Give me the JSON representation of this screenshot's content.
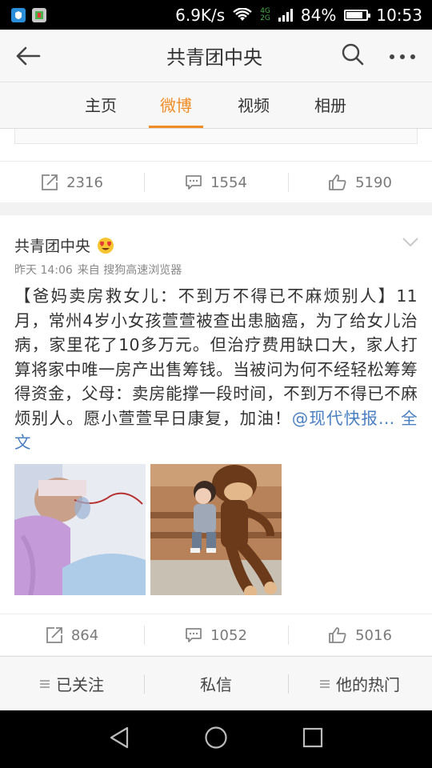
{
  "status_bar": {
    "net_speed": "6.9K/s",
    "net_4g": "4G",
    "net_2g": "2G",
    "battery": "84%",
    "battery_level": 0.84,
    "time": "10:53"
  },
  "header": {
    "title": "共青团中央"
  },
  "tabs": [
    {
      "label": "主页"
    },
    {
      "label": "微博",
      "active": true
    },
    {
      "label": "视频"
    },
    {
      "label": "相册"
    }
  ],
  "prev_post": {
    "reposts": "2316",
    "comments": "1554",
    "likes": "5190"
  },
  "post": {
    "author": "共青团中央",
    "time": "昨天 14:06",
    "source": "来自 搜狗高速浏览器",
    "text": "【爸妈卖房救女儿：不到万不得已不麻烦别人】11月，常州4岁小女孩萱萱被查出患脑癌，为了给女儿治病，家里花了10多万元。但治疗费用缺口大，家人打算将家中唯一房产出售筹钱。当被问为何不经轻松筹筹得资金，父母：卖房能撑一段时间，不到万不得已不麻烦别人。愿小萱萱早日康复，加油！",
    "mention": "@现代快报...",
    "full_text": "全文",
    "reposts": "864",
    "comments": "1052",
    "likes": "5016"
  },
  "bottom_bar": {
    "follow": "已关注",
    "message": "私信",
    "hot": "他的热门"
  },
  "colors": {
    "accent": "#f08c25",
    "link": "#4a7fc1"
  }
}
